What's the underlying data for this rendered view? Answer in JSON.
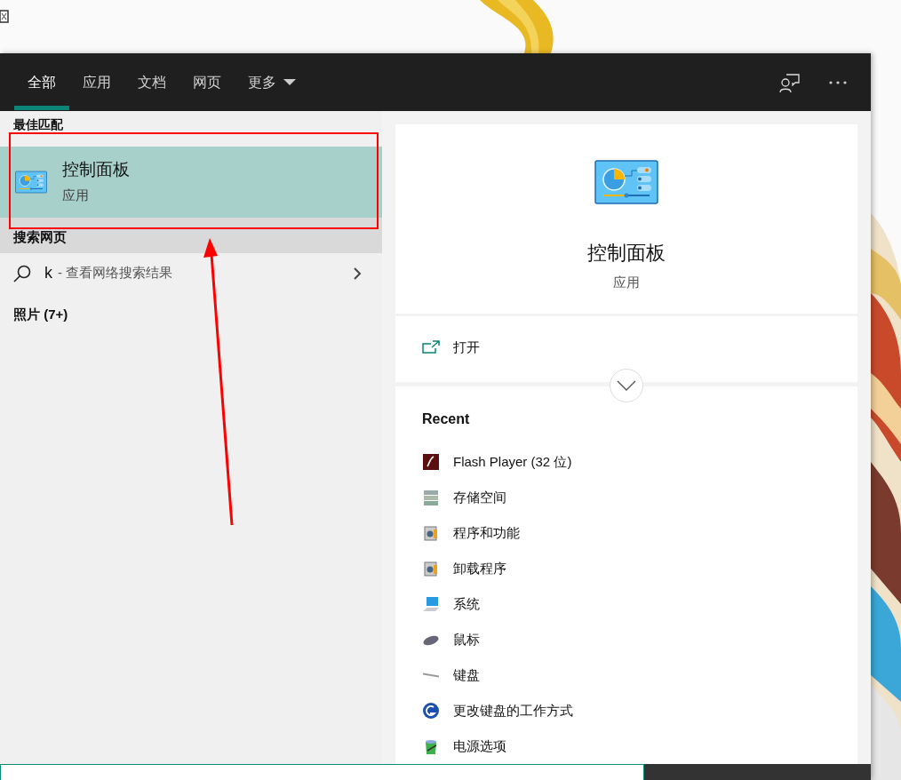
{
  "tabs": [
    {
      "label": "全部",
      "selected": true,
      "kind": "plain"
    },
    {
      "label": "应用",
      "selected": false,
      "kind": "plain"
    },
    {
      "label": "文档",
      "selected": false,
      "kind": "plain"
    },
    {
      "label": "网页",
      "selected": false,
      "kind": "plain"
    },
    {
      "label": "更多",
      "selected": false,
      "kind": "dropdown"
    }
  ],
  "left_panel": {
    "best_match": {
      "heading": "最佳匹配",
      "title": "控制面板",
      "subtitle": "应用",
      "selected": true
    },
    "web_search": {
      "heading": "搜索网页",
      "query": "k",
      "suffix": "- 查看网络搜索结果"
    },
    "photos": {
      "heading": "照片 (7+)"
    }
  },
  "preview": {
    "title": "控制面板",
    "subtitle": "应用",
    "actions": [
      {
        "label": "打开"
      }
    ],
    "recent_heading": "Recent",
    "recent": [
      {
        "label": "Flash Player (32 位)",
        "kind": "flash"
      },
      {
        "label": "存储空间",
        "kind": "storage"
      },
      {
        "label": "程序和功能",
        "kind": "programs"
      },
      {
        "label": "卸载程序",
        "kind": "programs"
      },
      {
        "label": "系统",
        "kind": "system"
      },
      {
        "label": "鼠标",
        "kind": "mouse"
      },
      {
        "label": "键盘",
        "kind": "keyboard"
      },
      {
        "label": "更改键盘的工作方式",
        "kind": "ease"
      },
      {
        "label": "电源选项",
        "kind": "power"
      }
    ]
  }
}
